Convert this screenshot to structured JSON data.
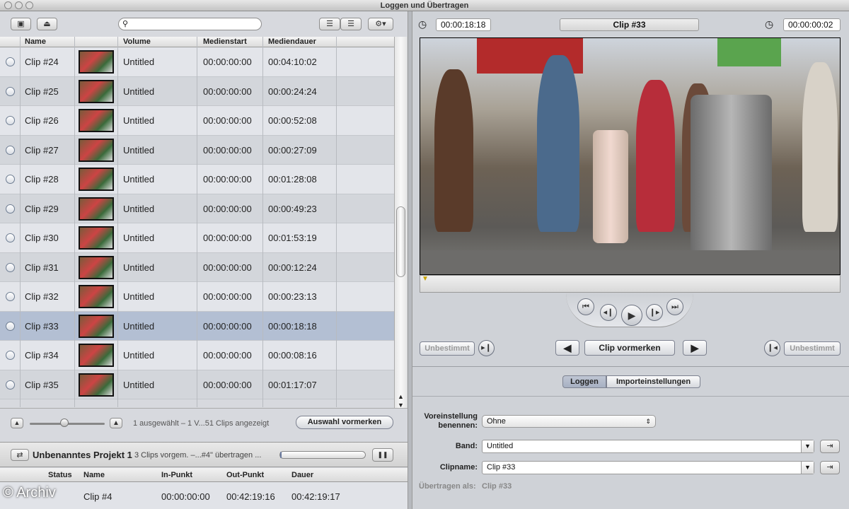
{
  "window": {
    "title": "Loggen und Übertragen"
  },
  "browser": {
    "search_placeholder": "",
    "columns": [
      "Name",
      "Volume",
      "Medienstart",
      "Mediendauer"
    ],
    "rows": [
      {
        "name": "Clip #24",
        "volume": "Untitled",
        "start": "00:00:00:00",
        "duration": "00:04:10:02"
      },
      {
        "name": "Clip #25",
        "volume": "Untitled",
        "start": "00:00:00:00",
        "duration": "00:00:24:24"
      },
      {
        "name": "Clip #26",
        "volume": "Untitled",
        "start": "00:00:00:00",
        "duration": "00:00:52:08"
      },
      {
        "name": "Clip #27",
        "volume": "Untitled",
        "start": "00:00:00:00",
        "duration": "00:00:27:09"
      },
      {
        "name": "Clip #28",
        "volume": "Untitled",
        "start": "00:00:00:00",
        "duration": "00:01:28:08"
      },
      {
        "name": "Clip #29",
        "volume": "Untitled",
        "start": "00:00:00:00",
        "duration": "00:00:49:23"
      },
      {
        "name": "Clip #30",
        "volume": "Untitled",
        "start": "00:00:00:00",
        "duration": "00:01:53:19"
      },
      {
        "name": "Clip #31",
        "volume": "Untitled",
        "start": "00:00:00:00",
        "duration": "00:00:12:24"
      },
      {
        "name": "Clip #32",
        "volume": "Untitled",
        "start": "00:00:00:00",
        "duration": "00:00:23:13"
      },
      {
        "name": "Clip #33",
        "volume": "Untitled",
        "start": "00:00:00:00",
        "duration": "00:00:18:18"
      },
      {
        "name": "Clip #34",
        "volume": "Untitled",
        "start": "00:00:00:00",
        "duration": "00:00:08:16"
      },
      {
        "name": "Clip #35",
        "volume": "Untitled",
        "start": "00:00:00:00",
        "duration": "00:01:17:07"
      }
    ],
    "selected_row": 9,
    "status_text": "1 ausgewählt – 1 V...51 Clips angezeigt",
    "queue_button": "Auswahl vormerken"
  },
  "project": {
    "name": "Unbenanntes Projekt 1",
    "status": "3 Clips vorgem. –...#4\" übertragen ...",
    "progress": 0.02,
    "pause_label": "❚❚",
    "columns": [
      "Status",
      "Name",
      "In-Punkt",
      "Out-Punkt",
      "Dauer"
    ],
    "rows": [
      {
        "name": "Clip #4",
        "in": "00:00:00:00",
        "out": "00:42:19:16",
        "duration": "00:42:19:17"
      }
    ]
  },
  "viewer": {
    "current_tc": "00:00:18:18",
    "clip_title": "Clip #33",
    "duration_tc": "00:00:00:02",
    "in_label": "Unbestimmt",
    "out_label": "Unbestimmt",
    "queue_clip_button": "Clip vormerken"
  },
  "tabs": [
    {
      "label": "Loggen",
      "active": true
    },
    {
      "label": "Importeinstellungen",
      "active": false
    }
  ],
  "log": {
    "preset_label": "Voreinstellung benennen:",
    "preset_value": "Ohne",
    "tape_label": "Band:",
    "tape_value": "Untitled",
    "clipname_label": "Clipname:",
    "clipname_value": "Clip #33",
    "transfer_as_label": "Übertragen als:",
    "transfer_as_value": "Clip #33"
  },
  "watermark": "© Archiv",
  "colors": {
    "selection": "#b3bfd3",
    "accent": "#6b7ba0"
  }
}
